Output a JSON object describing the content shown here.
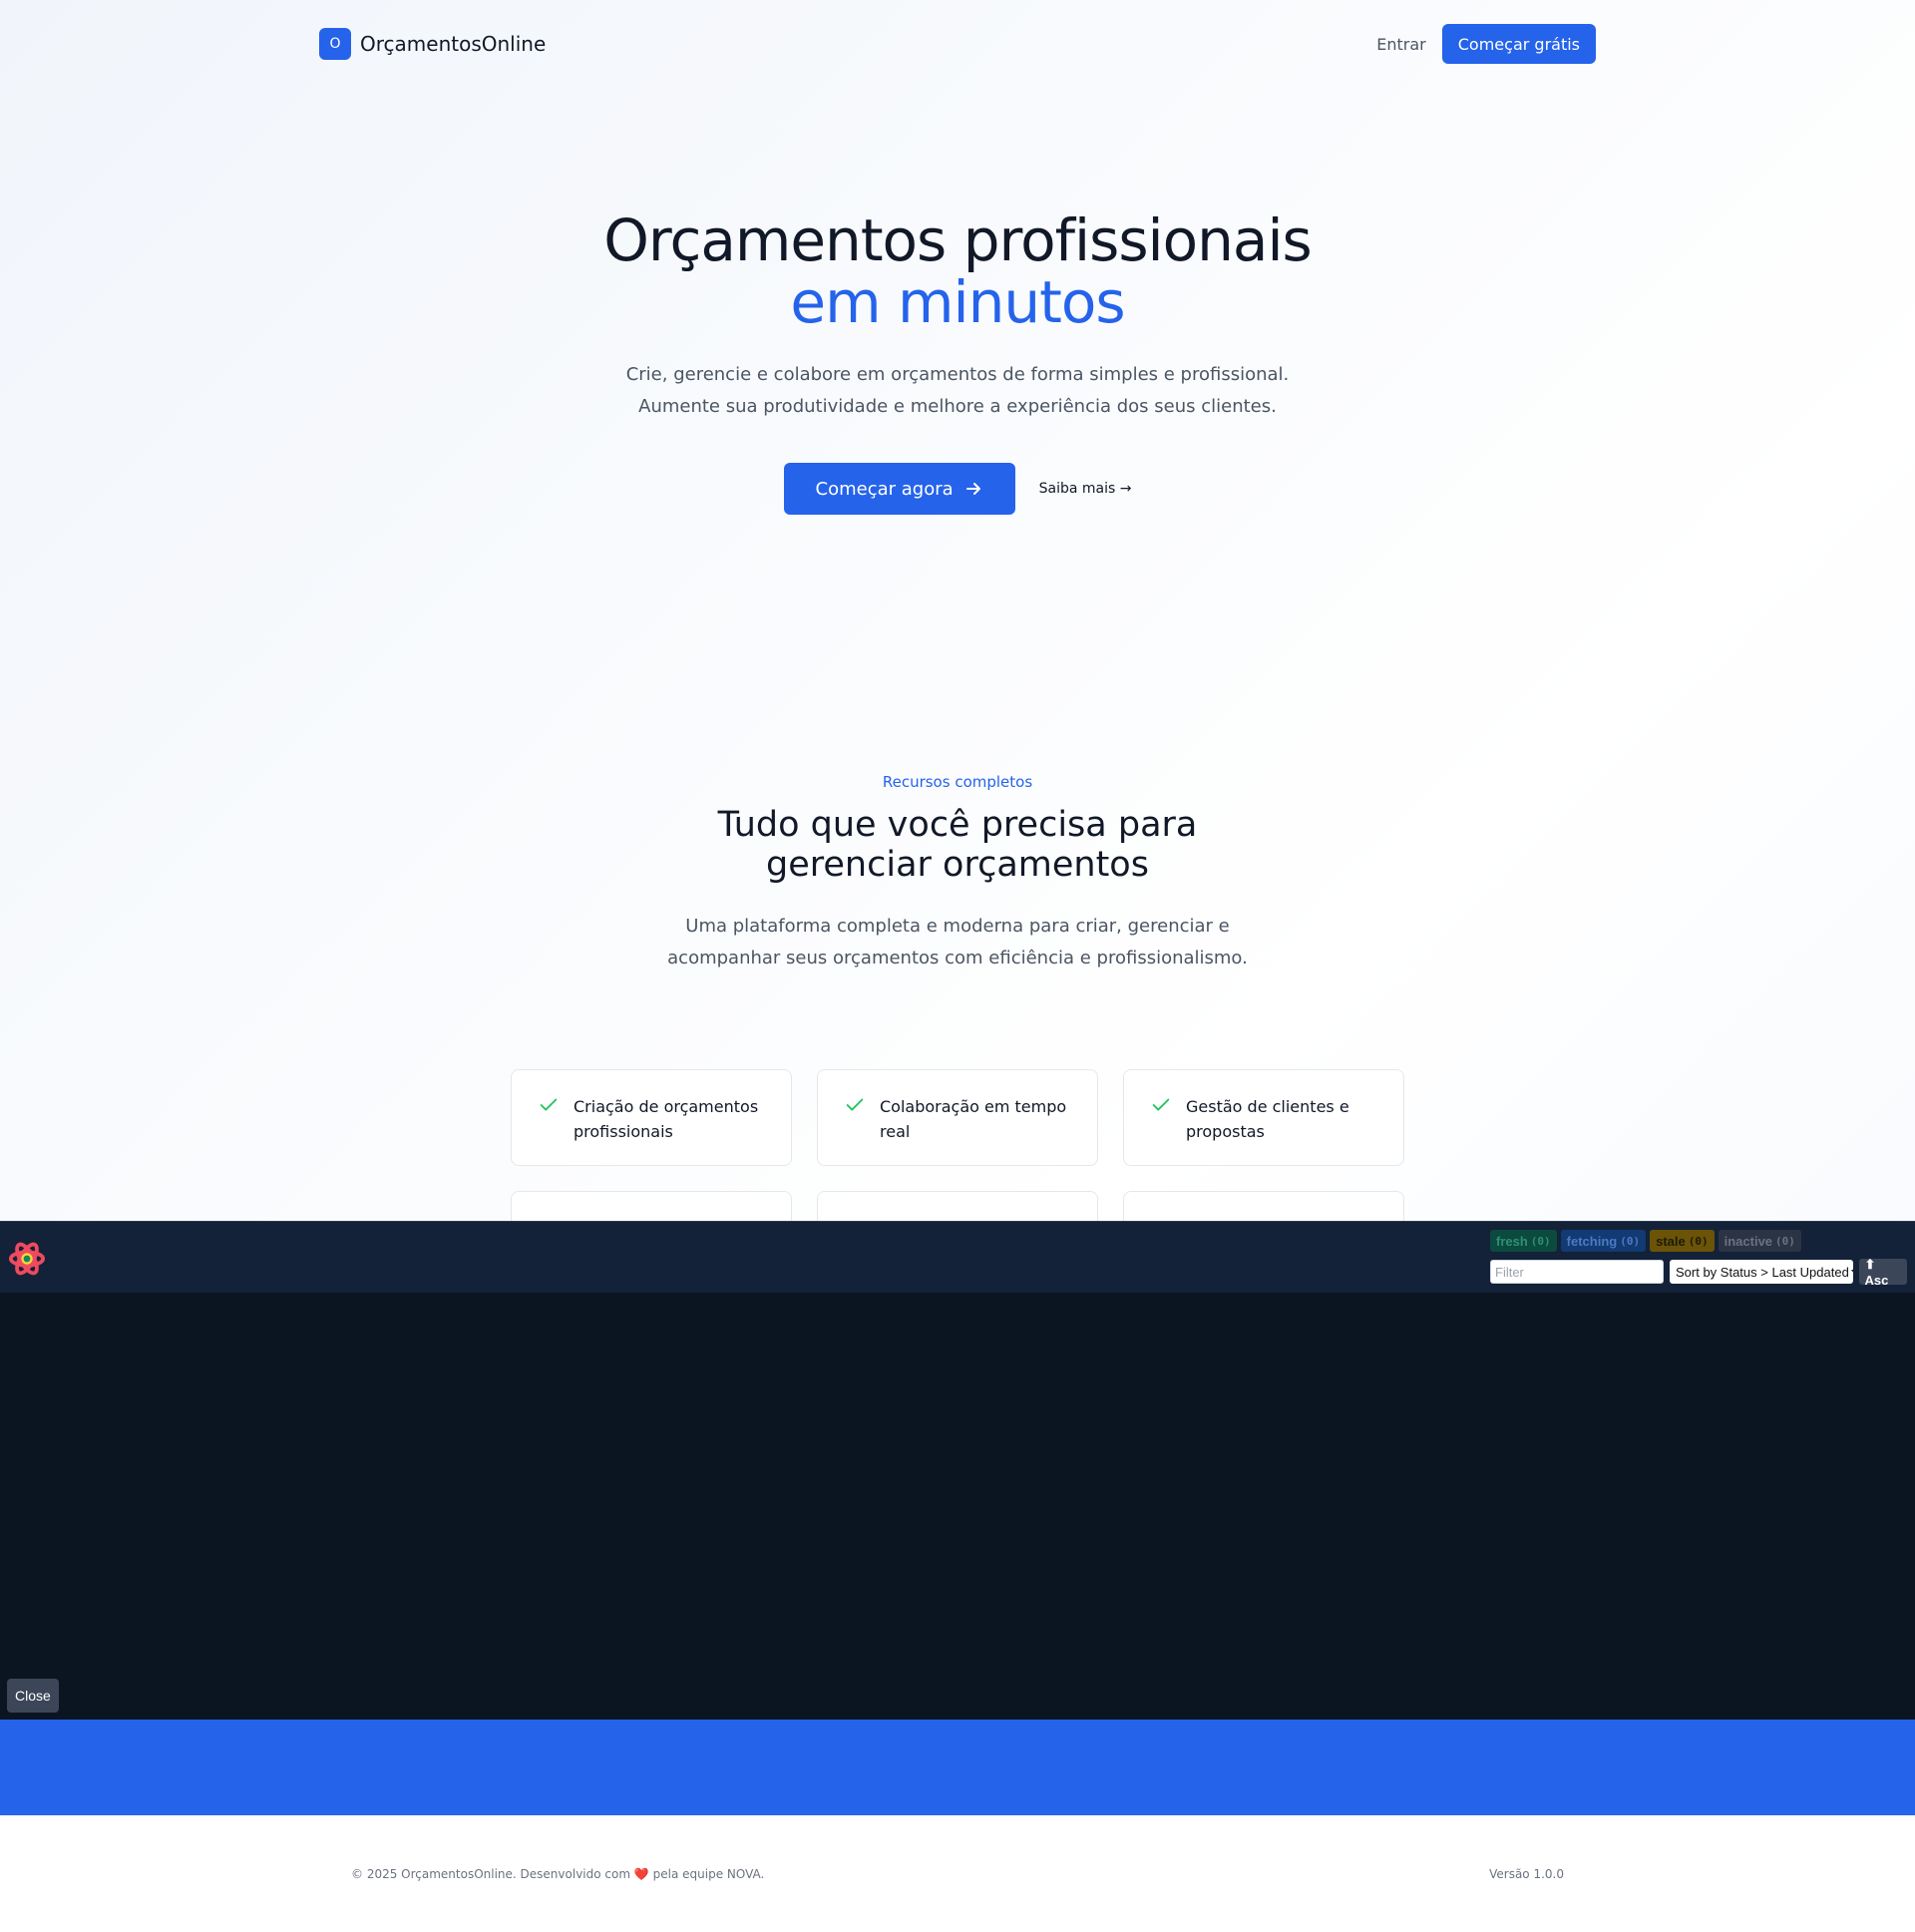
{
  "header": {
    "logo_letter": "O",
    "brand": "OrçamentosOnline",
    "login": "Entrar",
    "cta": "Começar grátis"
  },
  "hero": {
    "title_line1": "Orçamentos profissionais",
    "title_line2": "em minutos",
    "subtitle": "Crie, gerencie e colabore em orçamentos de forma simples e profissional. Aumente sua produtividade e melhore a experiência dos seus clientes.",
    "primary_cta": "Começar agora",
    "secondary_cta": "Saiba mais →"
  },
  "features": {
    "eyebrow": "Recursos completos",
    "title": "Tudo que você precisa para gerenciar orçamentos",
    "subtitle": "Uma plataforma completa e moderna para criar, gerenciar e acompanhar seus orçamentos com eficiência e profissionalismo.",
    "items": [
      {
        "label": "Criação de orçamentos profissionais"
      },
      {
        "label": "Colaboração em tempo real"
      },
      {
        "label": "Gestão de clientes e propostas"
      }
    ]
  },
  "devtools": {
    "badges": [
      {
        "label": "fresh",
        "count": "(0)"
      },
      {
        "label": "fetching",
        "count": "(0)"
      },
      {
        "label": "stale",
        "count": "(0)"
      },
      {
        "label": "inactive",
        "count": "(0)"
      }
    ],
    "filter_placeholder": "Filter",
    "sort_value": "Sort by Status > Last Updated",
    "order_label": "⬆ Asc",
    "close_label": "Close"
  },
  "footer": {
    "copyright_pre": "© 2025 OrçamentosOnline. Desenvolvido com",
    "heart": "❤️",
    "copyright_post": "pela equipe NOVA.",
    "version": "Versão 1.0.0"
  },
  "colors": {
    "primary": "#2563eb",
    "check": "#22c55e",
    "devtools_bg": "#0b1421"
  }
}
